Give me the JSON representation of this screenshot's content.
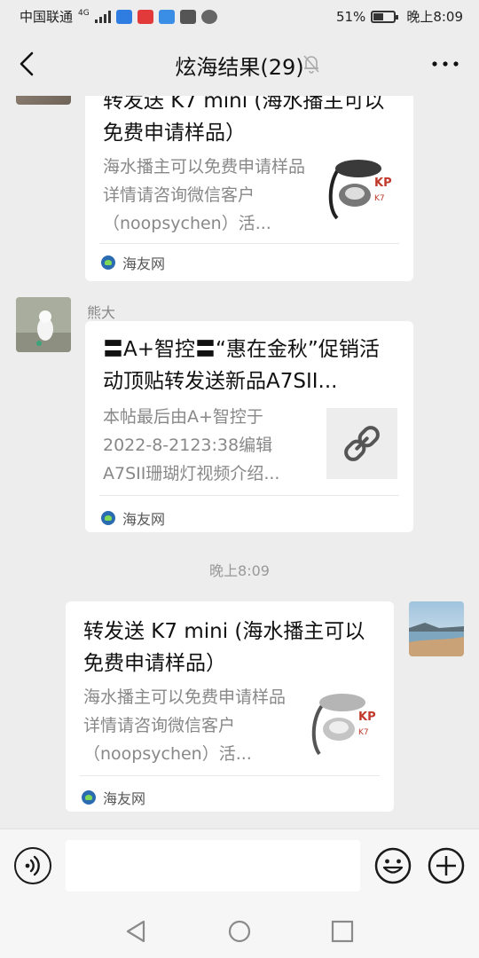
{
  "status_bar": {
    "carrier": "中国联通",
    "network": "4G",
    "battery_text": "51%",
    "battery_level": 0.51,
    "time": "晚上8:09"
  },
  "header": {
    "title": "炫海结果(29)",
    "back_icon": "chevron-left-icon",
    "mute_icon": "bell-off-icon",
    "more_icon": "more-dots-icon"
  },
  "messages": [
    {
      "title": "转发送 K7 mini (海水播主可以免费申请样品）",
      "desc": "海水播主可以免费申请样品详情请咨询微信客户（noopsychen）活...",
      "source": "海友网"
    },
    {
      "sender": "熊大",
      "title": "〓A+智控〓“惠在金秋”促销活动顶贴转发送新品A7SII...",
      "desc": "本帖最后由A+智控于2022-8-2123:38编辑A7SII珊瑚灯视频介绍...",
      "source": "海友网",
      "thumb_icon": "link-icon"
    },
    {
      "timestamp": "晚上8:09"
    },
    {
      "title": "转发送 K7 mini (海水播主可以免费申请样品）",
      "desc": "海水播主可以免费申请样品详情请咨询微信客户（noopsychen）活...",
      "source": "海友网"
    }
  ],
  "product_thumb": {
    "brand": "KP",
    "model": "K7"
  },
  "input_bar": {
    "voice_icon": "voice-icon",
    "emoji_icon": "emoji-icon",
    "plus_icon": "plus-icon",
    "value": ""
  },
  "nav_bar": {
    "back_icon": "nav-back-icon",
    "home_icon": "nav-home-icon",
    "recents_icon": "nav-recents-icon"
  },
  "colors": {
    "background": "#ededed",
    "card": "#ffffff",
    "muted_text": "#888888"
  }
}
